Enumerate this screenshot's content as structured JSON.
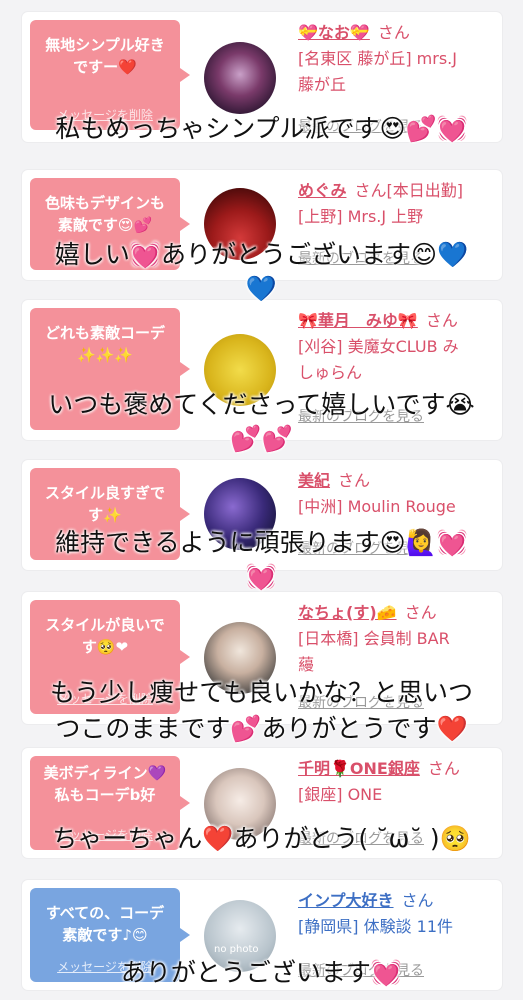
{
  "cards": [
    {
      "bubble_line1": "無地シンプル好き",
      "bubble_line2": "ですー❤️",
      "bubble_action": "メッセージを削除",
      "name": "💝なお💝",
      "honorific": "さん",
      "shop_line1": "[名東区 藤が丘] mrs.J",
      "shop_line2": "藤が丘",
      "blog_link": "最新のブログを見る",
      "overlay_line1": "私もめっちゃシンプル派です😍💕💓"
    },
    {
      "bubble_line1": "色味もデザインも",
      "bubble_line2": "素敵です😍💕",
      "name": "めぐみ",
      "honorific": "さん[本日出勤]",
      "shop_line1": "[上野] Mrs.J 上野",
      "blog_link": "最新のブログを見る",
      "overlay_line1": "嬉しい💓ありがとうございます😊💙",
      "overlay_line2": "💙"
    },
    {
      "bubble_line1": "どれも素敵コーデ",
      "bubble_line2": "✨✨✨",
      "name": "🎀華月　みゆ🎀",
      "honorific": "さん",
      "shop_line1": "[刈谷] 美魔女CLUB み",
      "shop_line2": "しゅらん",
      "blog_link": "最新のブログを見る",
      "overlay_line1": "いつも褒めてくださって嬉しいです😭",
      "overlay_line2": "💕💕"
    },
    {
      "bubble_line1": "スタイル良すぎで",
      "bubble_line2": "す✨",
      "name": "美紀",
      "honorific": "さん",
      "shop_line1": "[中洲] Moulin Rouge",
      "blog_link": "最新のブログを見る",
      "overlay_line1": "維持できるように頑張ります😍🙋‍♀️💓",
      "overlay_line2": "💓"
    },
    {
      "bubble_line1": "スタイルが良いで",
      "bubble_line2": "す🥺❤",
      "bubble_action": "メッセージを削除",
      "name": "なちょ(す)🧀",
      "honorific": "さん",
      "shop_line1": "[日本橋] 会員制 BAR",
      "shop_line2": "蘰",
      "blog_link": "最新のブログを見る",
      "overlay_line1": "もう少し痩せても良いかな？と思いつ",
      "overlay_line2": "つこのままです💕ありがとうです❤️"
    },
    {
      "bubble_line1": "美ボディライン💜",
      "bubble_line2": "私もコーデb好",
      "bubble_action": "メッセージを削除",
      "name": "千明🌹ONE銀座",
      "honorific": "さん",
      "shop_line1": "[銀座] ONE",
      "blog_link": "最新のブログを見る",
      "overlay_line1": "ちゃーちゃん❤️ありがとう( ˘ω˘ )🥺"
    },
    {
      "bubble_line1": "すべての、コーデ",
      "bubble_line2": "素敵です♪😊",
      "bubble_action": "メッセージを削除",
      "name": "インプ大好き",
      "honorific": "さん",
      "shop_line1": "[静岡県] 体験談 11件",
      "blog_link": "最新のブログを見る",
      "overlay_line1": "ありがとうございます💓",
      "avatar_text": "no photo"
    }
  ]
}
